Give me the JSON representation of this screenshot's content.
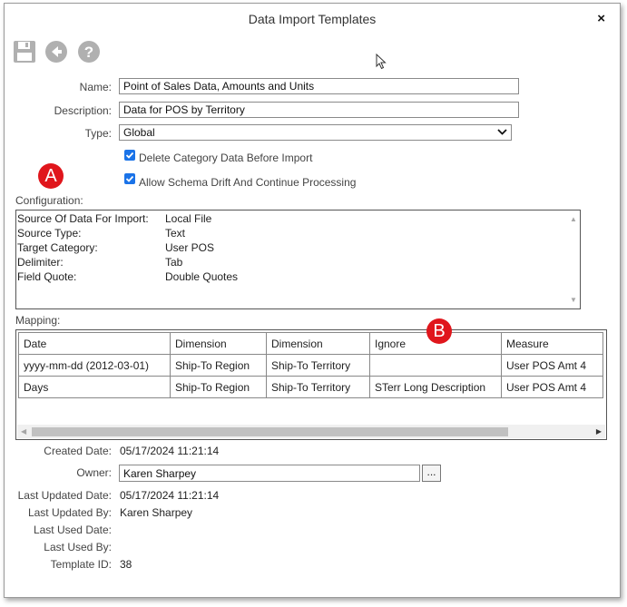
{
  "dialog": {
    "title": "Data Import Templates",
    "close_glyph": "×"
  },
  "toolbar": {
    "icons": [
      "save-icon",
      "back-icon",
      "help-icon"
    ]
  },
  "form": {
    "name_label": "Name:",
    "name_value": "Point of Sales Data, Amounts and Units",
    "description_label": "Description:",
    "description_value": "Data for POS by Territory",
    "type_label": "Type:",
    "type_value": "Global",
    "delete_category_label": "Delete Category Data Before Import",
    "delete_category_checked": true,
    "allow_schema_label": "Allow Schema Drift And Continue Processing",
    "allow_schema_checked": true
  },
  "markers": {
    "a": "A",
    "b": "B"
  },
  "configuration": {
    "label": "Configuration:",
    "rows": [
      {
        "key": "Source Of Data For Import:",
        "value": "Local File"
      },
      {
        "key": "Source Type:",
        "value": "Text"
      },
      {
        "key": "Target Category:",
        "value": "User POS"
      },
      {
        "key": "Delimiter:",
        "value": "Tab"
      },
      {
        "key": "Field Quote:",
        "value": "Double Quotes"
      }
    ]
  },
  "mapping": {
    "label": "Mapping:",
    "columns": [
      "Date",
      "Dimension",
      "Dimension",
      "Ignore",
      "Measure"
    ],
    "rows": [
      [
        "yyyy-mm-dd (2012-03-01)",
        "Ship-To Region",
        "Ship-To Territory",
        "",
        "User POS Amt 4"
      ],
      [
        "Days",
        "Ship-To Region",
        "Ship-To Territory",
        "STerr Long Description",
        "User POS Amt 4"
      ]
    ]
  },
  "info": {
    "created_date_label": "Created Date:",
    "created_date": "05/17/2024 11:21:14",
    "owner_label": "Owner:",
    "owner": "Karen Sharpey",
    "owner_button": "...",
    "last_updated_date_label": "Last Updated Date:",
    "last_updated_date": "05/17/2024 11:21:14",
    "last_updated_by_label": "Last Updated By:",
    "last_updated_by": "Karen Sharpey",
    "last_used_date_label": "Last Used Date:",
    "last_used_date": "",
    "last_used_by_label": "Last Used By:",
    "last_used_by": "",
    "template_id_label": "Template ID:",
    "template_id": "38"
  },
  "colors": {
    "marker": "#e0161c",
    "checkbox": "#1a73e8",
    "icon_gray": "#b0b0b0"
  }
}
